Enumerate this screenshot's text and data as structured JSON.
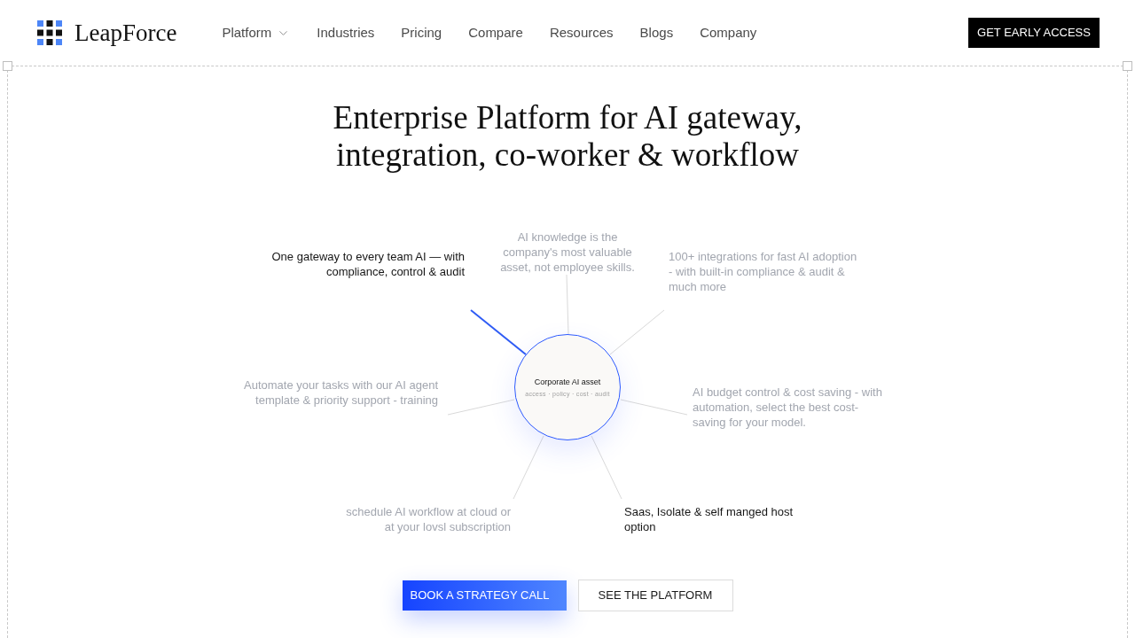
{
  "header": {
    "logo": {
      "text": "LeapForce"
    },
    "nav": [
      {
        "label": "Platform",
        "kind": "dropdown"
      },
      {
        "label": "Industries",
        "kind": "link"
      },
      {
        "label": "Pricing",
        "kind": "link"
      },
      {
        "label": "Compare",
        "kind": "link"
      },
      {
        "label": "Resources",
        "kind": "link"
      },
      {
        "label": "Blogs",
        "kind": "link"
      },
      {
        "label": "Company",
        "kind": "link"
      }
    ],
    "cta": "GET EARLY ACCESS"
  },
  "hero": {
    "title": "Enterprise Platform for AI gateway,\nintegration, co-worker & workflow"
  },
  "diagram": {
    "hub": {
      "title": "Corporate AI asset",
      "subtitle": "access · policy · cost · audit"
    },
    "nodes": [
      {
        "text": "One gateway to every team AI — with\ncompliance, control & audit",
        "emphasized": true,
        "selected": true
      },
      {
        "text": "AI knowledge is the\ncompany's most valuable\nasset, not employee skills.",
        "emphasized": false,
        "selected": false
      },
      {
        "text": "100+ integrations for fast AI adoption\n- with built-in compliance & audit &\nmuch more",
        "emphasized": false,
        "selected": false
      },
      {
        "text": "Automate your tasks with our AI agent\ntemplate & priority support - training",
        "emphasized": false,
        "selected": false
      },
      {
        "text": "AI budget control & cost saving - with\nautomation, select the best cost-\nsaving for your model.",
        "emphasized": false,
        "selected": false
      },
      {
        "text": "schedule AI workflow at cloud or\nat your lovsl subscription",
        "emphasized": false,
        "selected": false
      },
      {
        "text": "Saas, Isolate & self manged host\noption",
        "emphasized": true,
        "selected": false
      }
    ]
  },
  "buttons": [
    {
      "label": "BOOK A STRATEGY CALL",
      "kind": "primary"
    },
    {
      "label": "SEE THE PLATFORM",
      "kind": "secondary"
    }
  ]
}
